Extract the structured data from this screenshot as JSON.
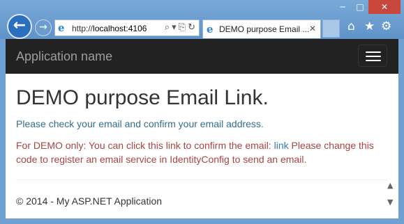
{
  "window": {
    "minimize_glyph": "─",
    "maximize_glyph": "□",
    "close_glyph": "✕"
  },
  "browser": {
    "back_glyph": "←",
    "forward_glyph": "→",
    "address_scheme": "http://",
    "address_host": "localhost:4106",
    "address_icons": "⌕▾⎘↻",
    "tab_title": "DEMO purpose Email ...",
    "tab_close_glyph": "✕",
    "home_glyph": "⌂",
    "favorites_glyph": "★",
    "tools_glyph": "⚙",
    "ie_icon_glyph": "e"
  },
  "navbar": {
    "brand": "Application name"
  },
  "page": {
    "heading": "DEMO purpose Email Link.",
    "info_text": "Please check your email and confirm your email address.",
    "danger_before": "For DEMO only: You can click this link to confirm the email: ",
    "danger_link": "link",
    "danger_after": " Please change this code to register an email service in IdentityConfig to send an email."
  },
  "footer": {
    "text": "© 2014 - My ASP.NET Application"
  },
  "scroll": {
    "up_glyph": "▲",
    "down_glyph": "▼"
  }
}
